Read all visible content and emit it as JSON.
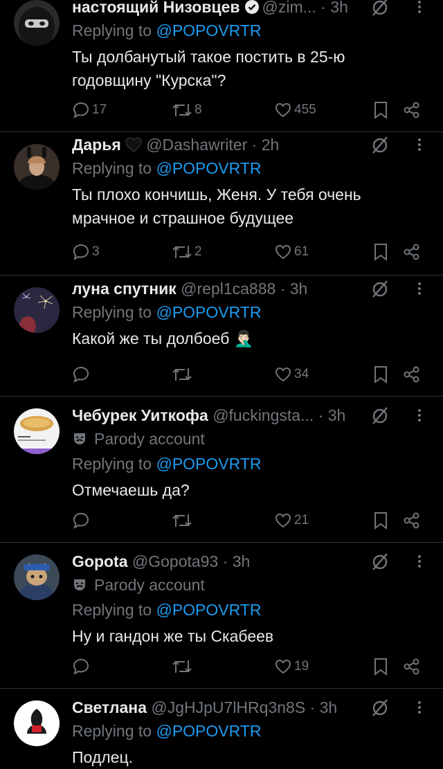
{
  "replying_label": "Replying to",
  "colors": {
    "background": "#000000",
    "text": "#e7e9ea",
    "secondary": "#71767b",
    "accent": "#1d9bf0",
    "divider": "#2f3336"
  },
  "tweets": [
    {
      "name": "настоящий Низовцев",
      "verified": true,
      "handle": "@zim...",
      "time": "· 3h",
      "reply_to": "@POPOVRTR",
      "text_lines": [
        "Ты долбанутый такое постить в 25-ю",
        "годовщину \"Курска\"?"
      ],
      "replies": "17",
      "reposts": "8",
      "likes": "455",
      "avatar": "balaclava-avatar"
    },
    {
      "name": "Дарья",
      "heart": true,
      "handle": "@Dashawriter",
      "time": "· 2h",
      "reply_to": "@POPOVRTR",
      "text_lines": [
        "Ты плохо кончишь, Женя. У тебя очень",
        "мрачное и страшное будущее"
      ],
      "replies": "3",
      "reposts": "2",
      "likes": "61",
      "avatar": "bunny-ears-avatar"
    },
    {
      "name": "луна спутник",
      "handle": "@repl1ca888",
      "time": "· 3h",
      "reply_to": "@POPOVRTR",
      "text_lines": [
        "Какой же ты долбоеб 🤦🏻‍♂️"
      ],
      "replies": "",
      "reposts": "",
      "likes": "34",
      "avatar": "fireworks-avatar"
    },
    {
      "name": "Чебурек Уиткофа",
      "handle": "@fuckingsta...",
      "time": "· 3h",
      "parody": "Parody account",
      "reply_to": "@POPOVRTR",
      "text_lines": [
        "Отмечаешь да?"
      ],
      "replies": "",
      "reposts": "",
      "likes": "21",
      "avatar": "cheburek-avatar"
    },
    {
      "name": "Gopota",
      "handle": "@Gopota93",
      "time": "· 3h",
      "parody": "Parody account",
      "reply_to": "@POPOVRTR",
      "text_lines": [
        "Ну и гандон же ты Скабеев"
      ],
      "replies": "",
      "reposts": "",
      "likes": "19",
      "avatar": "cat-hoodie-avatar"
    },
    {
      "name": "Светлана",
      "handle": "@JgHJpU7lHRq3n8S",
      "time": "· 3h",
      "reply_to": "@POPOVRTR",
      "text_lines": [
        "Подлец."
      ],
      "avatar": "logo-avatar"
    }
  ]
}
